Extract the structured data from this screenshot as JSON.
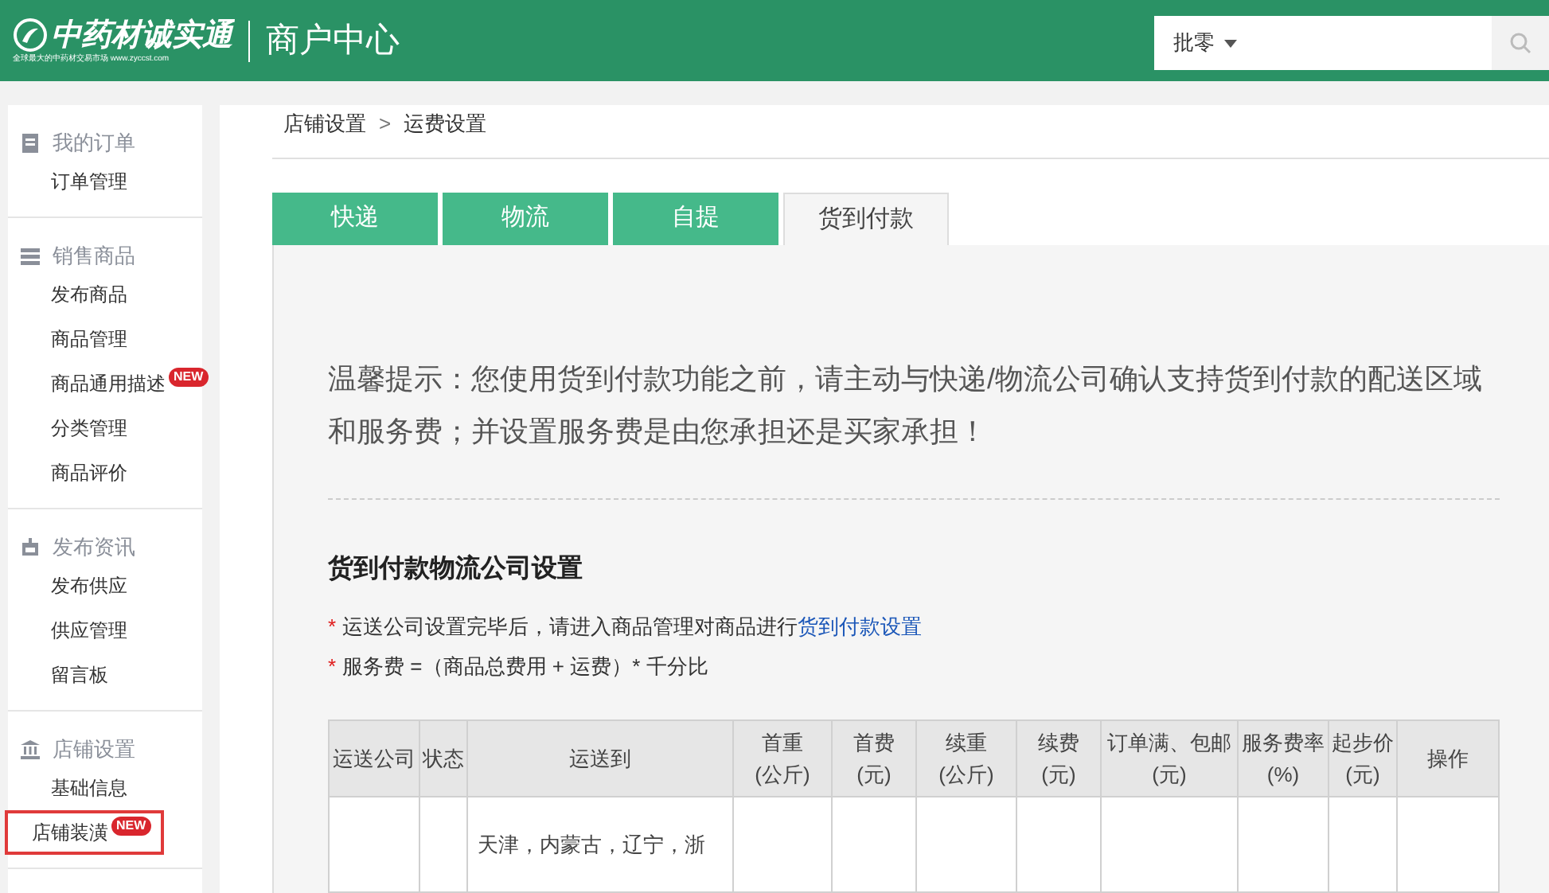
{
  "header": {
    "logo_text": "中药材诚实通",
    "logo_tagline": "全球最大的中药材交易市场 www.zyccst.com",
    "title": "商户中心",
    "search": {
      "category": "批零"
    }
  },
  "sidebar": [
    {
      "title": "我的订单",
      "items": [
        {
          "label": "订单管理",
          "outlined": false
        }
      ]
    },
    {
      "title": "销售商品",
      "items": [
        {
          "label": "发布商品",
          "outlined": false
        },
        {
          "label": "商品管理",
          "outlined": false
        },
        {
          "label": "商品通用描述",
          "badge": "NEW",
          "outlined": false
        },
        {
          "label": "分类管理",
          "outlined": false
        },
        {
          "label": "商品评价",
          "outlined": false
        }
      ]
    },
    {
      "title": "发布资讯",
      "items": [
        {
          "label": "发布供应",
          "outlined": false
        },
        {
          "label": "供应管理",
          "outlined": false
        },
        {
          "label": "留言板",
          "outlined": false
        }
      ]
    },
    {
      "title": "店铺设置",
      "items": [
        {
          "label": "基础信息",
          "outlined": false
        },
        {
          "label": "店铺装潢",
          "badge": "NEW",
          "outlined": true
        }
      ]
    }
  ],
  "breadcrumb": {
    "parent": "店铺设置",
    "separator": ">",
    "current": "运费设置"
  },
  "tabs": [
    {
      "label": "快递",
      "selected": false
    },
    {
      "label": "物流",
      "selected": false
    },
    {
      "label": "自提",
      "selected": false
    },
    {
      "label": "货到付款",
      "selected": true
    }
  ],
  "tip": "温馨提示：您使用货到付款功能之前，请主动与快递/物流公司确认支持货到付款的配送区域和服务费；并设置服务费是由您承担还是买家承担！",
  "section_title": "货到付款物流公司设置",
  "notes": [
    {
      "mark": "*",
      "text": "运送公司设置完毕后，请进入商品管理对商品进行",
      "link": "货到付款设置"
    },
    {
      "mark": "*",
      "text": "服务费 =（商品总费用 + 运费）* 千分比"
    }
  ],
  "table": {
    "columns": [
      {
        "label": "运送公司"
      },
      {
        "label": "状态"
      },
      {
        "label": "运送到"
      },
      {
        "label": "首重",
        "unit": "(公斤)"
      },
      {
        "label": "首费",
        "unit": "(元)"
      },
      {
        "label": "续重",
        "unit": "(公斤)"
      },
      {
        "label": "续费",
        "unit": "(元)"
      },
      {
        "label": "订单满、包邮",
        "unit": "(元)"
      },
      {
        "label": "服务费率",
        "unit": "(%)"
      },
      {
        "label": "起步价",
        "unit": "(元)"
      },
      {
        "label": "操作"
      }
    ],
    "rows": [
      [
        "",
        "",
        "天津，内蒙古，辽宁，浙",
        "",
        "",
        "",
        "",
        "",
        "",
        "",
        ""
      ]
    ]
  }
}
